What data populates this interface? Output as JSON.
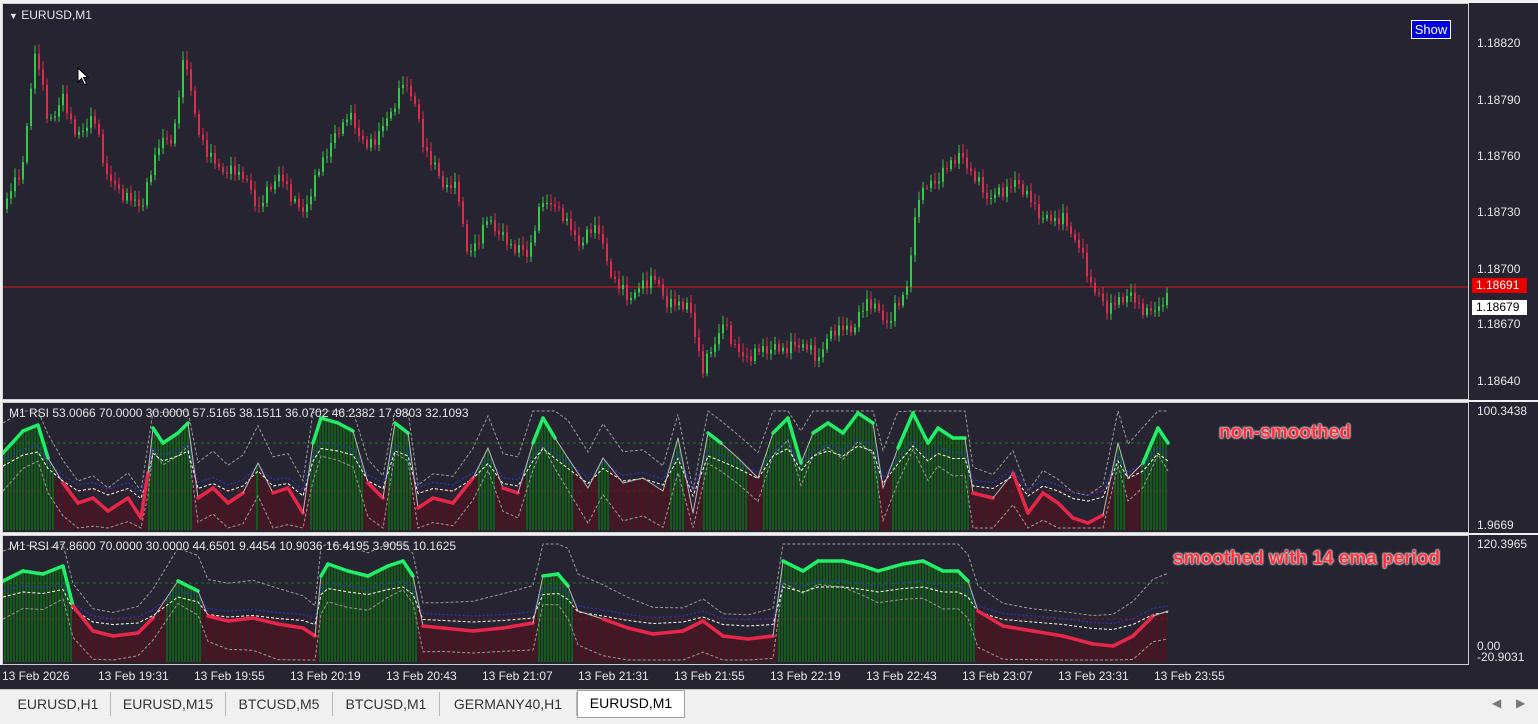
{
  "symbol_label": "EURUSD,M1",
  "show_button": "Show",
  "main": {
    "price_ticks": [
      "1.18820",
      "1.18790",
      "1.18760",
      "1.18730",
      "1.18700",
      "1.18670",
      "1.18640"
    ],
    "current_price_red": "1.18691",
    "current_price_white": "1.18679",
    "colors": {
      "bull": "#2ecc40",
      "bear": "#e0294b",
      "hline": "#d11a1a"
    }
  },
  "rsi1": {
    "label": "M1 RSI  53.0066 70.0000 30.0000 57.5165 38.1511 36.0702 46.2382 17.9803 32.1093",
    "axis_top": "100.3438",
    "axis_bottom": "1.9669",
    "annotation": "non-smoothed"
  },
  "rsi2": {
    "label": "M1 RSI  47.8600 70.0000 30.0000 44.6501 9.4454 10.9036 16.4195 3.9055 10.1625",
    "axis_top": "120.3965",
    "axis_mid": "0.00",
    "axis_bottom": "-20.9031",
    "annotation": "smoothed with 14 ema period"
  },
  "time_ticks": [
    "13 Feb 2026",
    "13 Feb 19:31",
    "13 Feb 19:55",
    "13 Feb 20:19",
    "13 Feb 20:43",
    "13 Feb 21:07",
    "13 Feb 21:31",
    "13 Feb 21:55",
    "13 Feb 22:19",
    "13 Feb 22:43",
    "13 Feb 23:07",
    "13 Feb 23:31",
    "13 Feb 23:55"
  ],
  "tabs": [
    {
      "label": "EURUSD,H1",
      "active": false
    },
    {
      "label": "EURUSD,M15",
      "active": false
    },
    {
      "label": "BTCUSD,M5",
      "active": false
    },
    {
      "label": "BTCUSD,M1",
      "active": false
    },
    {
      "label": "GERMANY40,H1",
      "active": false
    },
    {
      "label": "EURUSD,M1",
      "active": true
    }
  ],
  "icons": {
    "pane_menu": "triangle-down-icon",
    "cursor": "mouse-pointer-icon",
    "scroll_left": "chevron-left-icon",
    "scroll_right": "chevron-right-icon"
  }
}
